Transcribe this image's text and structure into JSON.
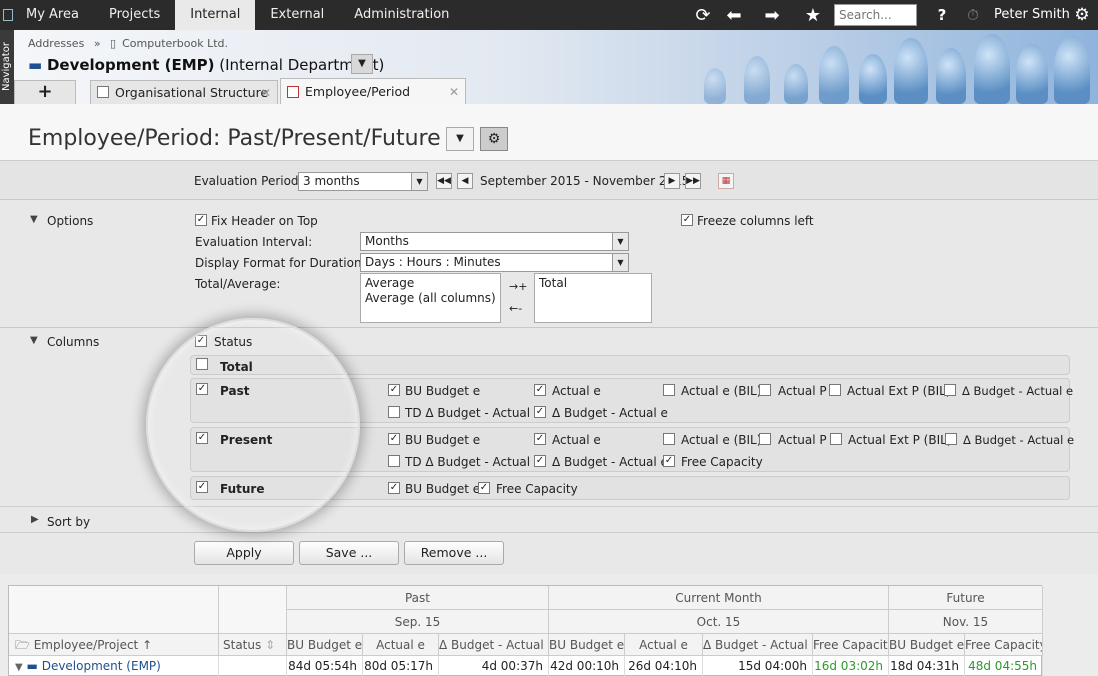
{
  "topbar": {
    "nav": [
      "My Area",
      "Projects",
      "Internal",
      "External",
      "Administration"
    ],
    "active": "Internal",
    "search_placeholder": "Search...",
    "user": "Peter Smith",
    "help": "?"
  },
  "navigator_label": "Navigator",
  "breadcrumb": {
    "addresses": "Addresses",
    "sep": "»",
    "company": "Computerbook Ltd."
  },
  "entity": {
    "name": "Development (EMP)",
    "type": "(Internal Department)"
  },
  "tabs": [
    {
      "label": "Organisational Structure"
    },
    {
      "label": "Employee/Period"
    }
  ],
  "add_tab": "+",
  "page_title": "Employee/Period: Past/Present/Future",
  "evaluation": {
    "label": "Evaluation Period",
    "value": "3 months",
    "range": "September 2015 - November 2015"
  },
  "options": {
    "section": "Options",
    "fix_header": "Fix Header on Top",
    "freeze_columns": "Freeze columns left",
    "interval_label": "Evaluation Interval:",
    "interval_value": "Months",
    "duration_label": "Display Format for Duration:",
    "duration_value": "Days : Hours : Minutes",
    "total_label": "Total/Average:",
    "available": [
      "Average",
      "Average (all columns)"
    ],
    "selected": [
      "Total"
    ],
    "move_right": "→+",
    "move_left": "←-"
  },
  "columns": {
    "section": "Columns",
    "status": "Status",
    "total": "Total",
    "past": {
      "label": "Past",
      "items": [
        {
          "label": "BU Budget e",
          "checked": true
        },
        {
          "label": "Actual e",
          "checked": true
        },
        {
          "label": "Actual e (BIL)",
          "checked": false
        },
        {
          "label": "Actual P",
          "checked": false
        },
        {
          "label": "Actual Ext P (BIL)",
          "checked": false
        },
        {
          "label": "Δ Budget - Actual e",
          "checked": false
        },
        {
          "label": "TD Δ Budget - Actual e",
          "checked": false
        },
        {
          "label": "Δ Budget - Actual e",
          "checked": true
        }
      ]
    },
    "present": {
      "label": "Present",
      "items": [
        {
          "label": "BU Budget e",
          "checked": true
        },
        {
          "label": "Actual e",
          "checked": true
        },
        {
          "label": "Actual e (BIL)",
          "checked": false
        },
        {
          "label": "Actual P",
          "checked": false
        },
        {
          "label": "Actual Ext P (BIL)",
          "checked": false
        },
        {
          "label": "Δ Budget - Actual e",
          "checked": false
        },
        {
          "label": "TD Δ Budget - Actual e",
          "checked": false
        },
        {
          "label": "Δ Budget - Actual e",
          "checked": true
        },
        {
          "label": "Free Capacity",
          "checked": true
        }
      ]
    },
    "future": {
      "label": "Future",
      "items": [
        {
          "label": "BU Budget e",
          "checked": true
        },
        {
          "label": "Free Capacity",
          "checked": true
        }
      ]
    }
  },
  "sort_by": "Sort by",
  "buttons": {
    "apply": "Apply",
    "save": "Save ...",
    "remove": "Remove ..."
  },
  "grid": {
    "groups": [
      {
        "label": "Past",
        "month": "Sep. 15"
      },
      {
        "label": "Current Month",
        "month": "Oct. 15"
      },
      {
        "label": "Future",
        "month": "Nov. 15"
      }
    ],
    "col_headers": [
      "Employee/Project",
      "Status",
      "BU Budget e",
      "Actual e",
      "Δ Budget - Actual e",
      "BU Budget e",
      "Actual e",
      "Δ Budget - Actual e",
      "Free Capacity",
      "BU Budget e",
      "Free Capacity"
    ],
    "row": {
      "name": "Development (EMP)",
      "status": "",
      "values": [
        "84d 05:54h",
        "80d 05:17h",
        "4d 00:37h",
        "42d 00:10h",
        "26d 04:10h",
        "15d 04:00h",
        "16d 03:02h",
        "18d 04:31h",
        "48d 04:55h"
      ]
    }
  },
  "colors": {
    "topbar": "#2b2b2b",
    "accent": "#1f4f8f",
    "green": "#2a9a2a"
  }
}
